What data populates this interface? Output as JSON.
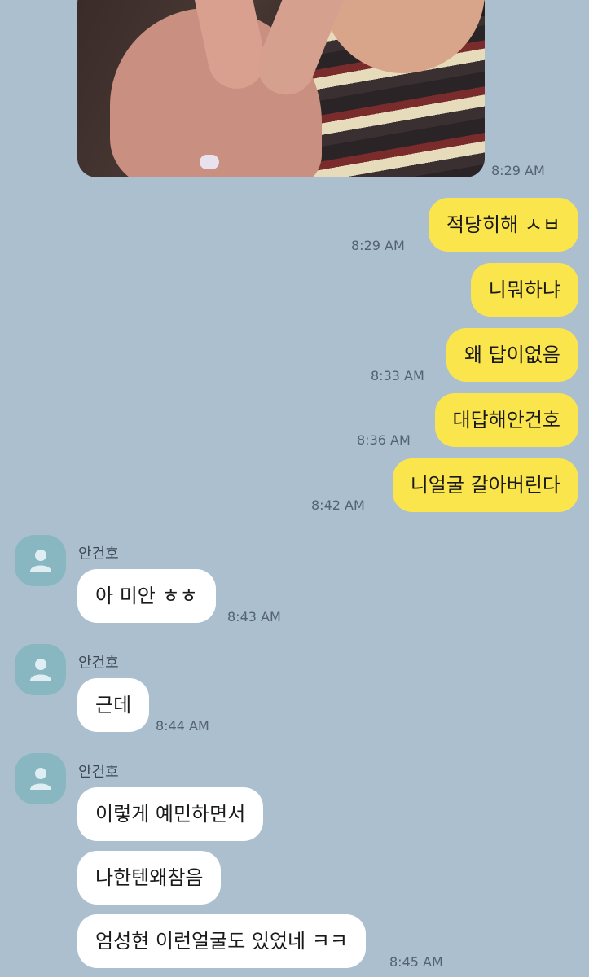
{
  "photo": {
    "time": "8:29 AM",
    "description_icon": "photo-image"
  },
  "me_messages": [
    {
      "text": "적당히해 ㅅㅂ",
      "time": "8:29 AM"
    },
    {
      "text": "니뭐하냐"
    },
    {
      "text": "왜 답이없음",
      "time": "8:33 AM"
    },
    {
      "text": "대답해안건호",
      "time": "8:36 AM"
    },
    {
      "text": "니얼굴 갈아버린다",
      "time": "8:42 AM"
    }
  ],
  "other_groups": [
    {
      "name": "안건호",
      "messages": [
        {
          "text": "아 미안 ㅎㅎ",
          "time": "8:43 AM"
        }
      ]
    },
    {
      "name": "안건호",
      "messages": [
        {
          "text": "근데",
          "time": "8:44 AM"
        }
      ]
    },
    {
      "name": "안건호",
      "messages": [
        {
          "text": "이렇게 예민하면서"
        },
        {
          "text": "나한텐왜참음"
        },
        {
          "text": "엄성현 이런얼굴도 있었네 ㅋㅋ",
          "time": "8:45 AM"
        }
      ]
    }
  ],
  "colors": {
    "background": "#abbfcf",
    "my_bubble": "#fbe54d",
    "other_bubble": "#ffffff",
    "avatar": "#88b7c2"
  },
  "icons": {
    "avatar": "default-profile-icon"
  }
}
